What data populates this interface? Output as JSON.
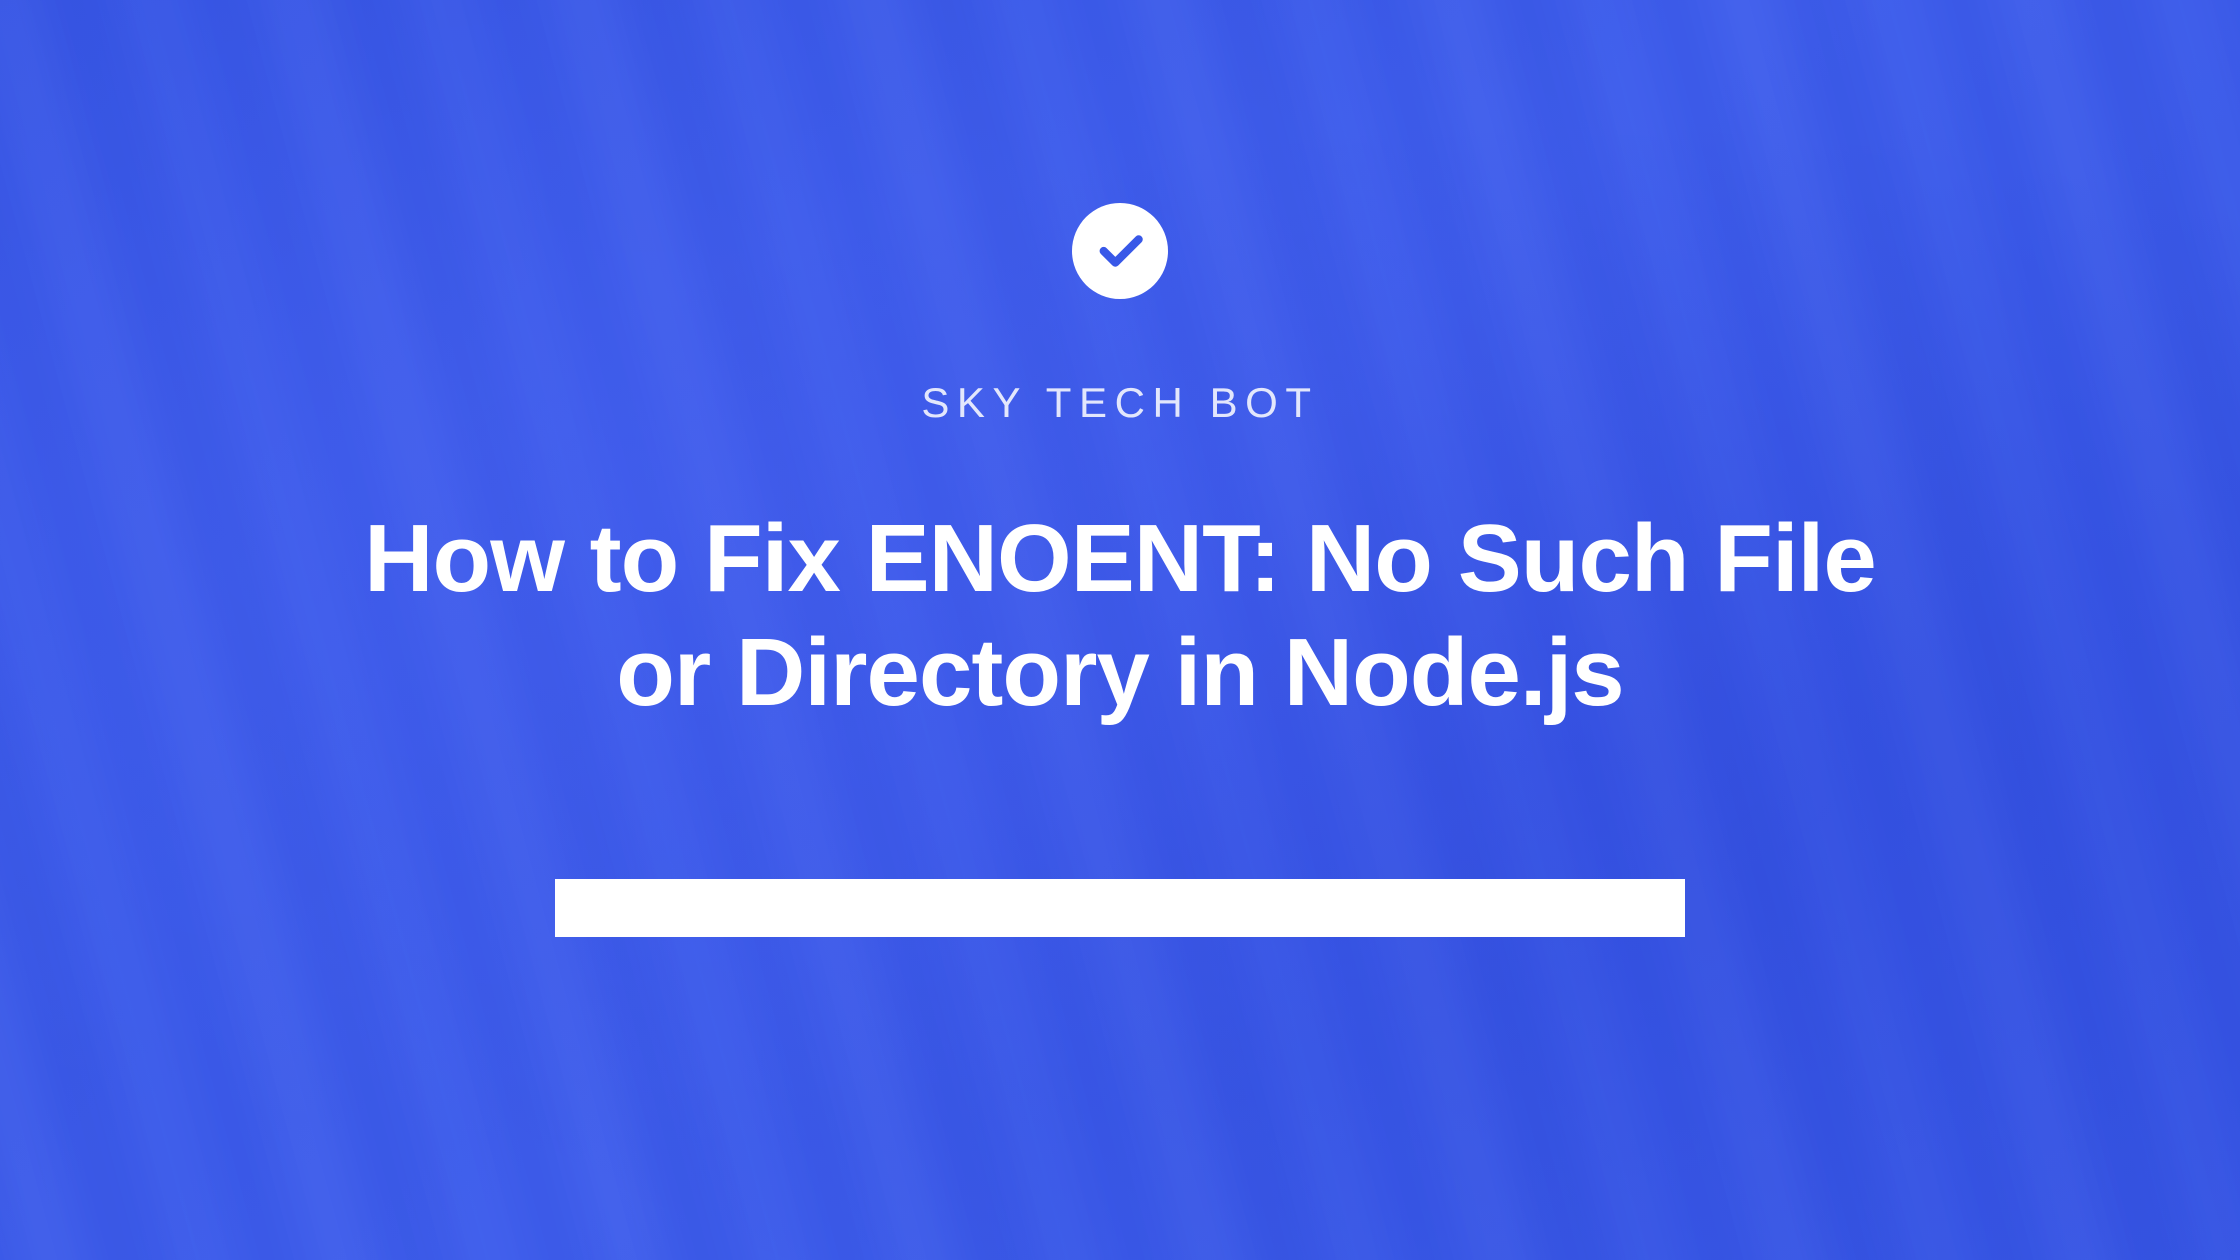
{
  "eyebrow": "SKY TECH BOT",
  "title": "How to Fix ENOENT: No Such File or Directory in Node.js",
  "colors": {
    "background_primary": "#3858e8",
    "text": "#ffffff"
  }
}
